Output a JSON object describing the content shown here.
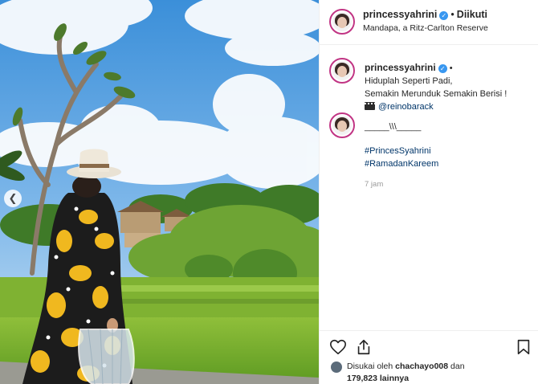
{
  "header": {
    "username": "princessyahrini",
    "separator": "•",
    "follow_status": "Diikuti",
    "location": "Mandapa, a Ritz-Carlton Reserve"
  },
  "caption": {
    "username": "princessyahrini",
    "separator": "•",
    "lines": [
      "Hiduplah Seperti Padi,",
      "Semakin Merunduk Semakin Berisi !"
    ],
    "credit_mention": "@reinobarack"
  },
  "comment": {
    "text": "_____\\\\\\_____",
    "hashtags": [
      "#PrincesSyahrini",
      "#RamadanKareem"
    ]
  },
  "timestamp": "7 jam",
  "likes": {
    "prefix": "Disukai oleh",
    "user": "chachayo008",
    "joiner": "dan",
    "count": "179,823",
    "suffix": "lainnya"
  },
  "icons": {
    "like": "heart-icon",
    "share": "share-icon",
    "save": "bookmark-icon",
    "verified": "verified-badge-icon",
    "carousel_prev": "chevron-left-icon"
  },
  "colors": {
    "verified": "#3897f0",
    "link": "#003569",
    "avatar_ring": "#c13584",
    "muted": "#999999"
  }
}
